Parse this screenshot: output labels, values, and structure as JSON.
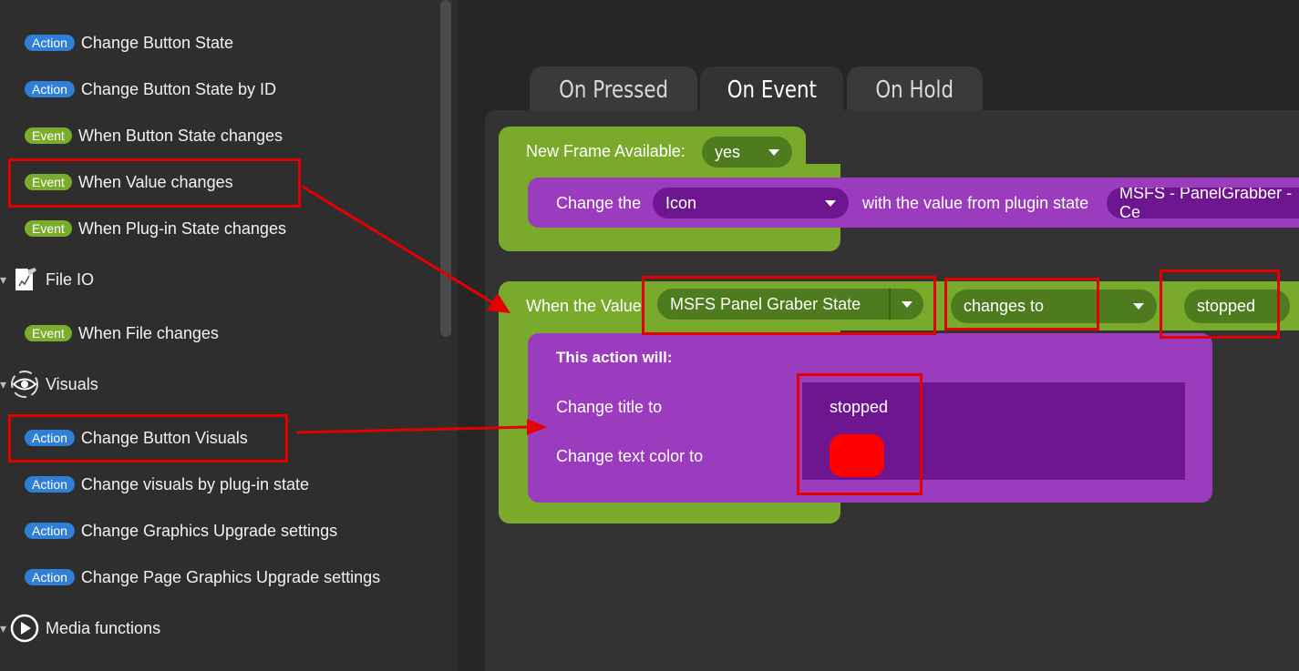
{
  "sidebar": {
    "items": [
      {
        "badge": "Action",
        "label": "Change Button State"
      },
      {
        "badge": "Action",
        "label": "Change Button State by ID"
      },
      {
        "badge": "Event",
        "label": "When Button State changes"
      },
      {
        "badge": "Event",
        "label": "When Value changes"
      },
      {
        "badge": "Event",
        "label": "When Plug-in State changes"
      },
      {
        "badge": "Event",
        "label": "When File changes"
      },
      {
        "badge": "Action",
        "label": "Change Button Visuals"
      },
      {
        "badge": "Action",
        "label": "Change visuals by plug-in state"
      },
      {
        "badge": "Action",
        "label": "Change Graphics Upgrade settings"
      },
      {
        "badge": "Action",
        "label": "Change Page Graphics Upgrade settings"
      }
    ],
    "categories": [
      {
        "label": "File IO",
        "icon": "file-edit-icon"
      },
      {
        "label": "Visuals",
        "icon": "eye-icon"
      },
      {
        "label": "Media functions",
        "icon": "play-icon"
      }
    ]
  },
  "tabs": [
    {
      "label": "On Pressed"
    },
    {
      "label": "On Event"
    },
    {
      "label": "On Hold"
    }
  ],
  "block1": {
    "header_label": "New Frame Available:",
    "header_value": "yes",
    "row_prefix": "Change the",
    "row_select": "Icon",
    "row_middle": "with the value from plugin state",
    "row_state": "MSFS - PanelGrabber - Ce"
  },
  "block2": {
    "header_label": "When the Value",
    "value_select": "MSFS Panel Graber State",
    "operator_select": "changes to",
    "compare_value": "stopped",
    "action_title": "This action will:",
    "title_label": "Change title to",
    "title_value": "stopped",
    "color_label": "Change text color to",
    "text_color": "#ff0000"
  },
  "colors": {
    "action_badge": "#2f7fd6",
    "event_badge": "#7aad2e",
    "block_green": "#7aaa2c",
    "block_purple": "#9a3cbd",
    "highlight_red": "#e50000"
  }
}
